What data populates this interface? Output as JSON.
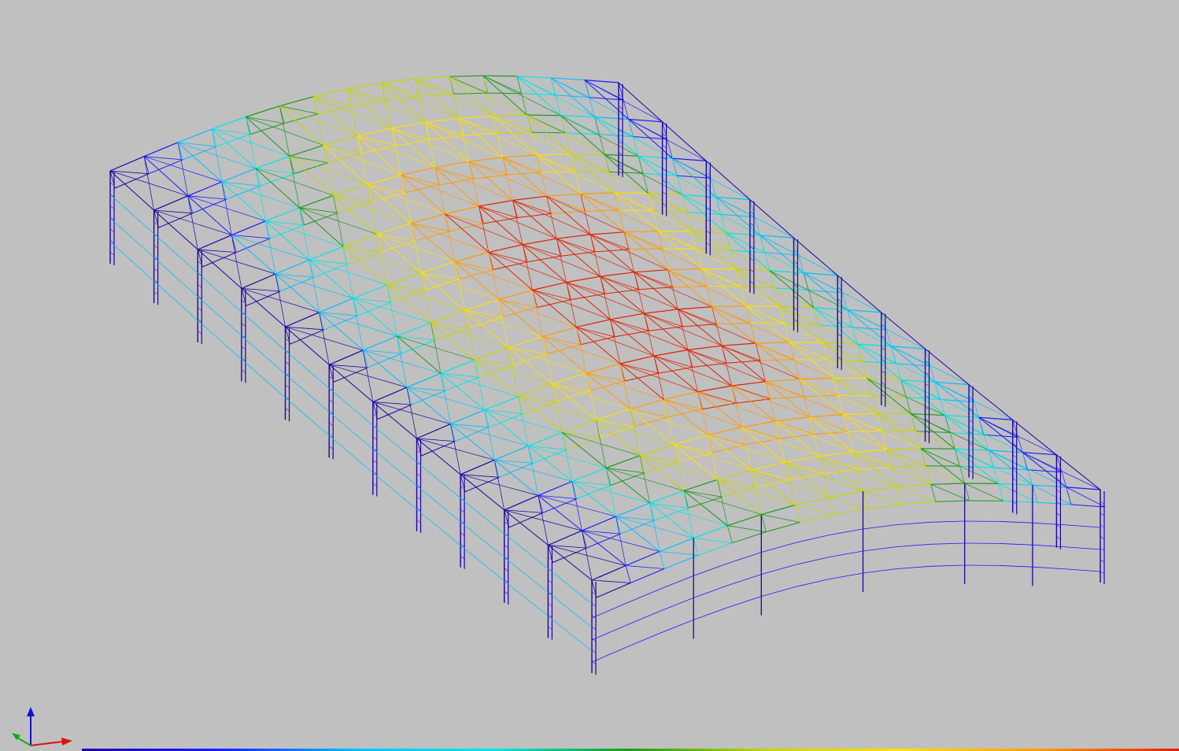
{
  "app": {
    "view": "isometric-3d",
    "background_color": "#c0c0c0"
  },
  "model": {
    "type": "steel-truss-roof-structure",
    "render_mode": "wireframe-colored-by-result",
    "frames": 12,
    "bays": 11,
    "roof_nodes_per_frame": 16,
    "colormap": [
      "#2000a0",
      "#1a1aff",
      "#00bfff",
      "#00e5e5",
      "#1a9a1a",
      "#c8d400",
      "#ffe000",
      "#ff9a00",
      "#e02000"
    ]
  },
  "axis_triad": {
    "axes": [
      {
        "name": "x",
        "color": "#dd1111"
      },
      {
        "name": "y",
        "color": "#11aa11"
      },
      {
        "name": "z",
        "color": "#1111cc"
      }
    ]
  },
  "colorbar": {
    "colors": [
      "#2000a0",
      "#1a1aff",
      "#00bfff",
      "#00e5e5",
      "#1a9a1a",
      "#c8d400",
      "#ffe000",
      "#ff9a00",
      "#e02000"
    ]
  }
}
